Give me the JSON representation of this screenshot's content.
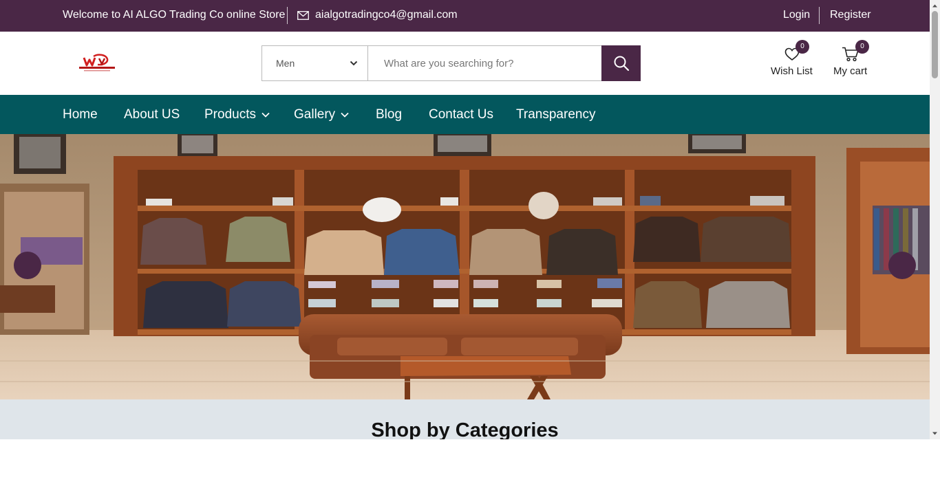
{
  "topbar": {
    "welcome": "Welcome to AI ALGO Trading Co online Store",
    "email": "aialgotradingco4@gmail.com",
    "login": "Login",
    "register": "Register"
  },
  "header": {
    "category": {
      "selected": "Men"
    },
    "search": {
      "placeholder": "What are you searching for?",
      "value": ""
    },
    "wishlist": {
      "label": "Wish List",
      "count": "0"
    },
    "cart": {
      "label": "My cart",
      "count": "0"
    }
  },
  "nav": {
    "items": [
      {
        "label": "Home",
        "dropdown": false
      },
      {
        "label": "About US",
        "dropdown": false
      },
      {
        "label": "Products",
        "dropdown": true
      },
      {
        "label": "Gallery",
        "dropdown": true
      },
      {
        "label": "Blog",
        "dropdown": false
      },
      {
        "label": "Contact Us",
        "dropdown": false
      },
      {
        "label": "Transparency",
        "dropdown": false
      }
    ]
  },
  "hero": {
    "image": "suit-store-interior",
    "arrows": [
      "prev-arrow",
      "next-arrow"
    ]
  },
  "categories": {
    "title": "Shop by Categories"
  },
  "icons": [
    "mail-icon",
    "chevron-down-icon",
    "search-icon",
    "heart-icon",
    "cart-icon"
  ],
  "colors": {
    "brand_purple": "#4a2746",
    "nav_teal": "#03575d",
    "category_bg": "#dfe5ea"
  }
}
